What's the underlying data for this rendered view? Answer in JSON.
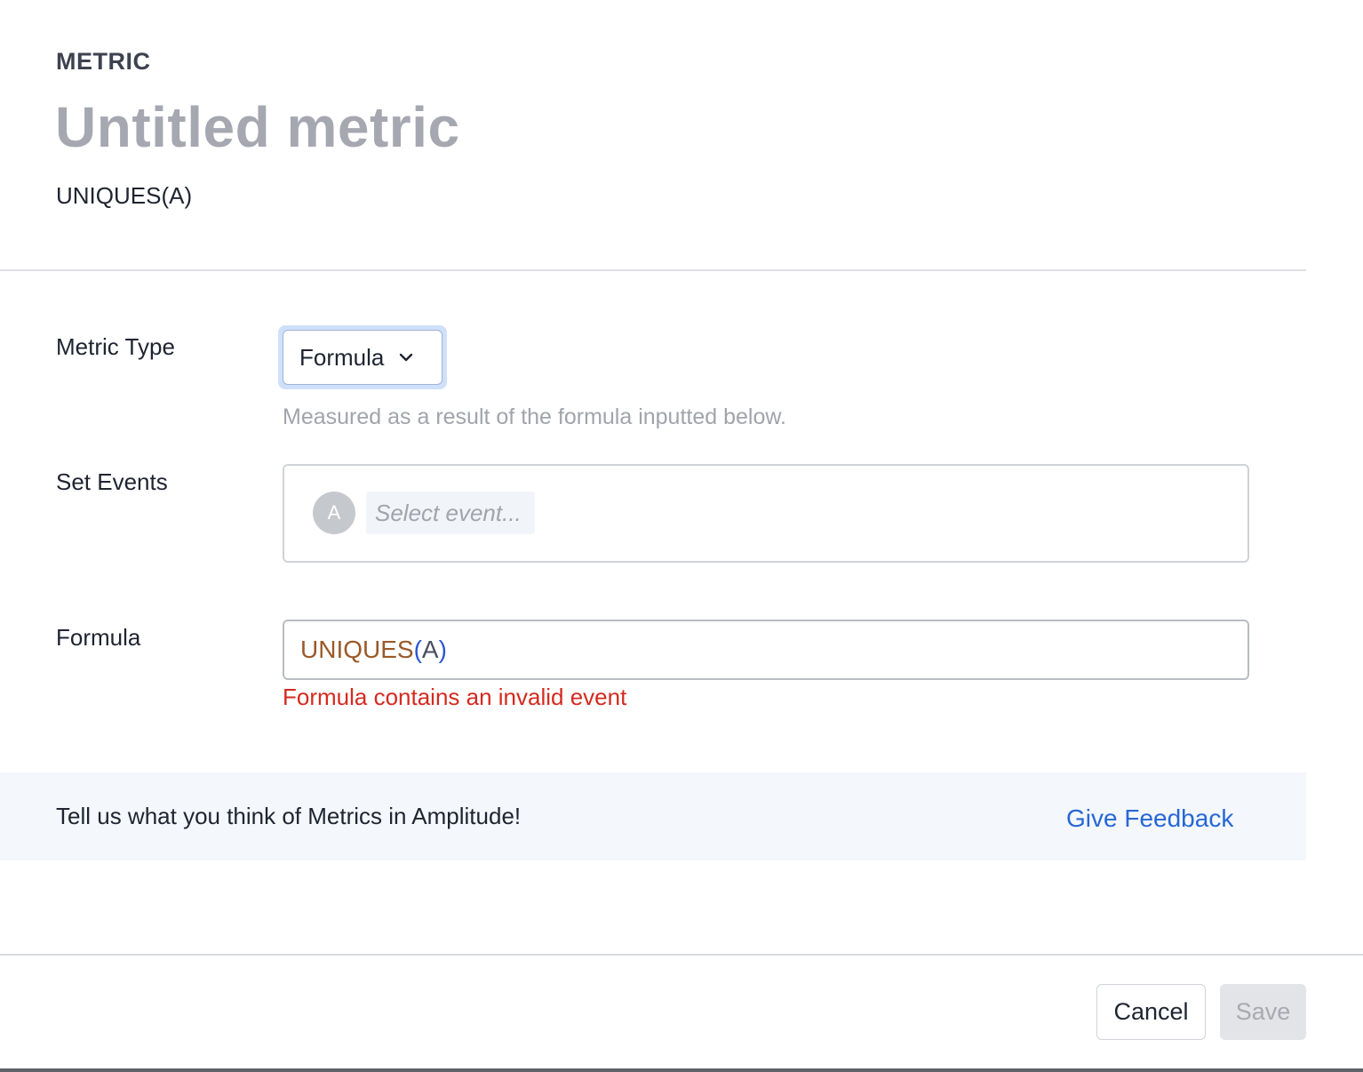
{
  "header": {
    "eyebrow": "METRIC",
    "title": "Untitled metric",
    "formula_summary": "UNIQUES(A)"
  },
  "metric_type": {
    "label": "Metric Type",
    "selected": "Formula",
    "helper": "Measured as a result of the formula inputted below."
  },
  "set_events": {
    "label": "Set Events",
    "items": [
      {
        "letter": "A",
        "placeholder": "Select event..."
      }
    ]
  },
  "formula": {
    "label": "Formula",
    "function_name": "UNIQUES",
    "open_paren": "(",
    "argument": "A",
    "close_paren": ")",
    "error": "Formula contains an invalid event"
  },
  "feedback": {
    "text": "Tell us what you think of Metrics in Amplitude!",
    "link": "Give Feedback"
  },
  "footer": {
    "cancel_label": "Cancel",
    "save_label": "Save",
    "save_enabled": false
  },
  "colors": {
    "accent_link": "#2767d6",
    "error": "#d42a1f",
    "formula_function": "#9a5a2a",
    "formula_paren": "#2b55d6",
    "title_muted": "#a5a8b0"
  },
  "icons": {
    "select_chevron": "chevron-down-icon"
  }
}
